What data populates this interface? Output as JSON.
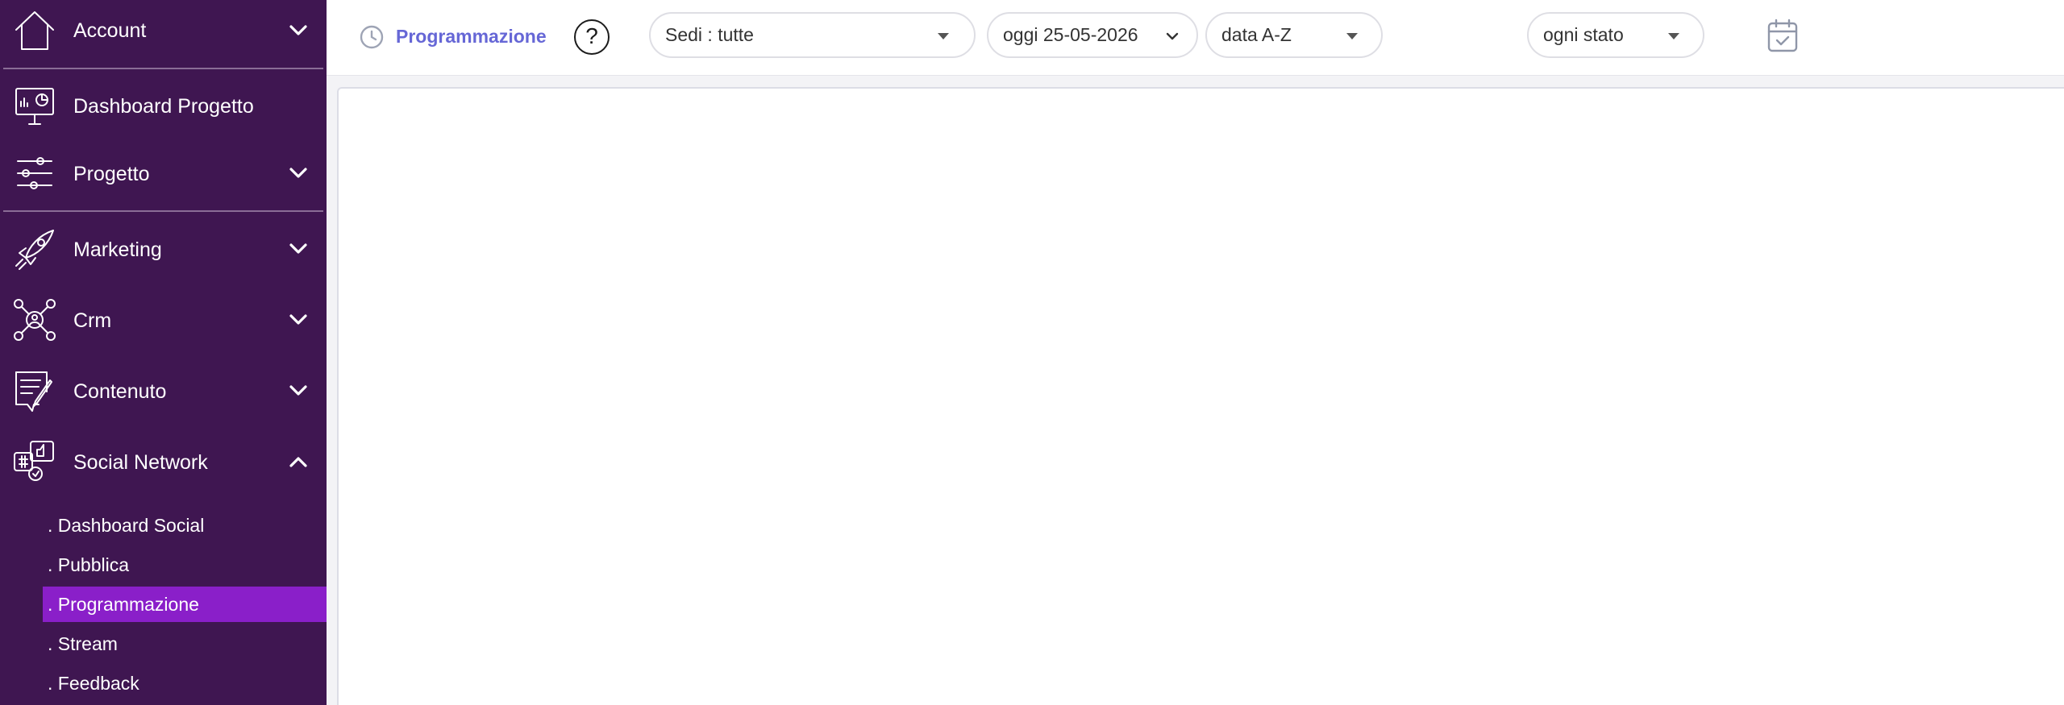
{
  "sidebar": {
    "items": [
      {
        "label": "Account",
        "icon": "home-icon",
        "expanded": false
      },
      {
        "label": "Dashboard Progetto",
        "icon": "monitor-dashboard-icon"
      },
      {
        "label": "Progetto",
        "icon": "sliders-icon",
        "expanded": false
      },
      {
        "label": "Marketing",
        "icon": "rocket-icon",
        "expanded": false
      },
      {
        "label": "Crm",
        "icon": "user-network-icon",
        "expanded": false
      },
      {
        "label": "Contenuto",
        "icon": "edit-document-icon",
        "expanded": false
      },
      {
        "label": "Social Network",
        "icon": "social-network-icon",
        "expanded": true
      }
    ],
    "social_sub": [
      {
        "label": ". Dashboard Social",
        "active": false
      },
      {
        "label": ". Pubblica",
        "active": false
      },
      {
        "label": ". Programmazione",
        "active": true
      },
      {
        "label": ". Stream",
        "active": false
      },
      {
        "label": ". Feedback",
        "active": false
      }
    ]
  },
  "topbar": {
    "title": "Programmazione",
    "title_icon": "clock-icon",
    "help_label": "?",
    "filters": {
      "sedi": "Sedi : tutte",
      "date": "oggi 25-05-2026",
      "sort": "data A-Z",
      "status": "ogni stato"
    },
    "calendar_icon": "calendar-check-icon"
  },
  "colors": {
    "sidebar_bg": "#3f1651",
    "active_sub_bg": "#8a1fc9",
    "title_color": "#6667d6"
  }
}
